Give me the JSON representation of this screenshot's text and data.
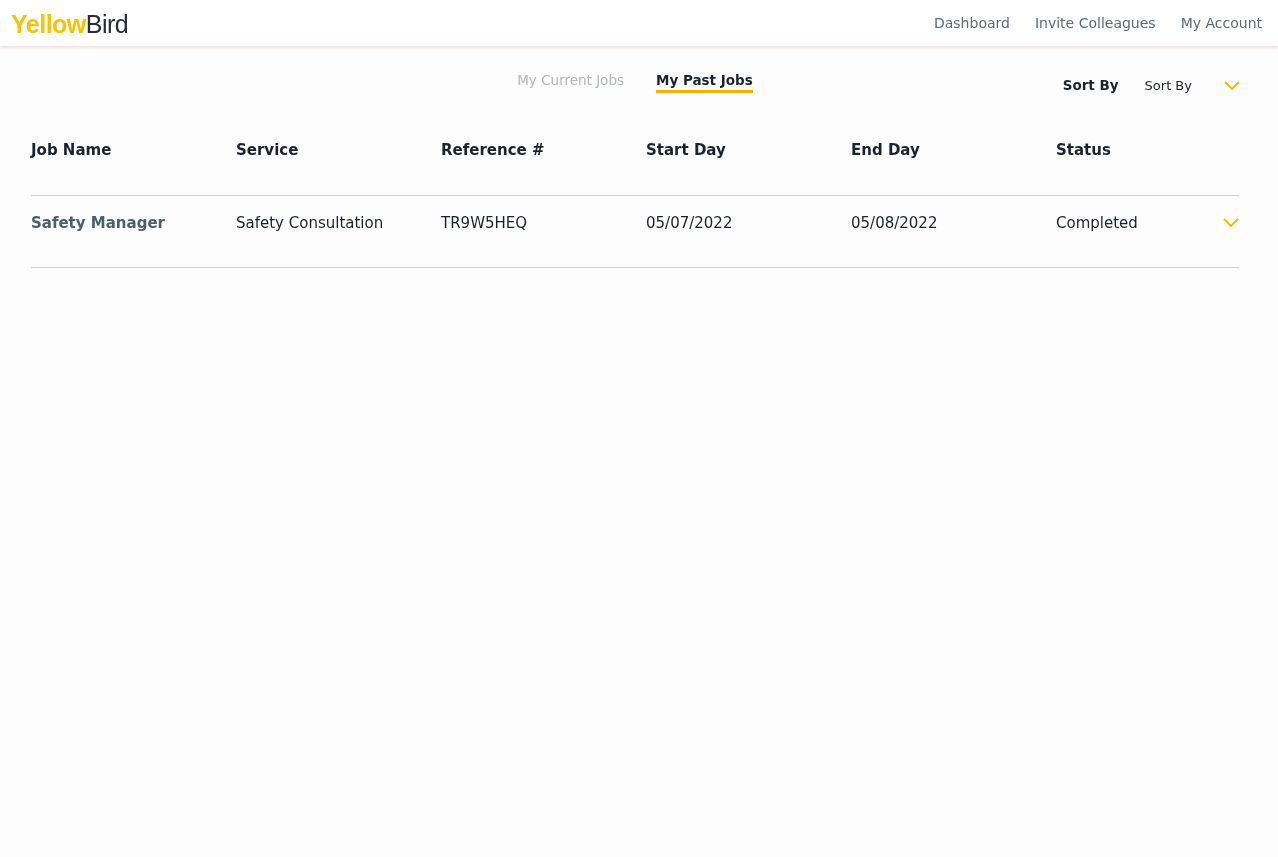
{
  "header": {
    "logo": {
      "first": "Yellow",
      "second": "Bird"
    },
    "nav": [
      "Dashboard",
      "Invite Colleagues",
      "My Account"
    ]
  },
  "tabs": [
    {
      "label": "My Current Jobs",
      "selected": false
    },
    {
      "label": "My Past Jobs",
      "selected": true
    }
  ],
  "sort": {
    "label": "Sort By",
    "value": "Sort By"
  },
  "table": {
    "columns": [
      "Job Name",
      "Service",
      "Reference #",
      "Start Day",
      "End Day",
      "Status"
    ],
    "rows": [
      {
        "cells": [
          "Safety Manager",
          "Safety Consultation",
          "TR9W5HEQ",
          "05/07/2022",
          "05/08/2022",
          "Completed"
        ],
        "expanded": false
      }
    ]
  }
}
